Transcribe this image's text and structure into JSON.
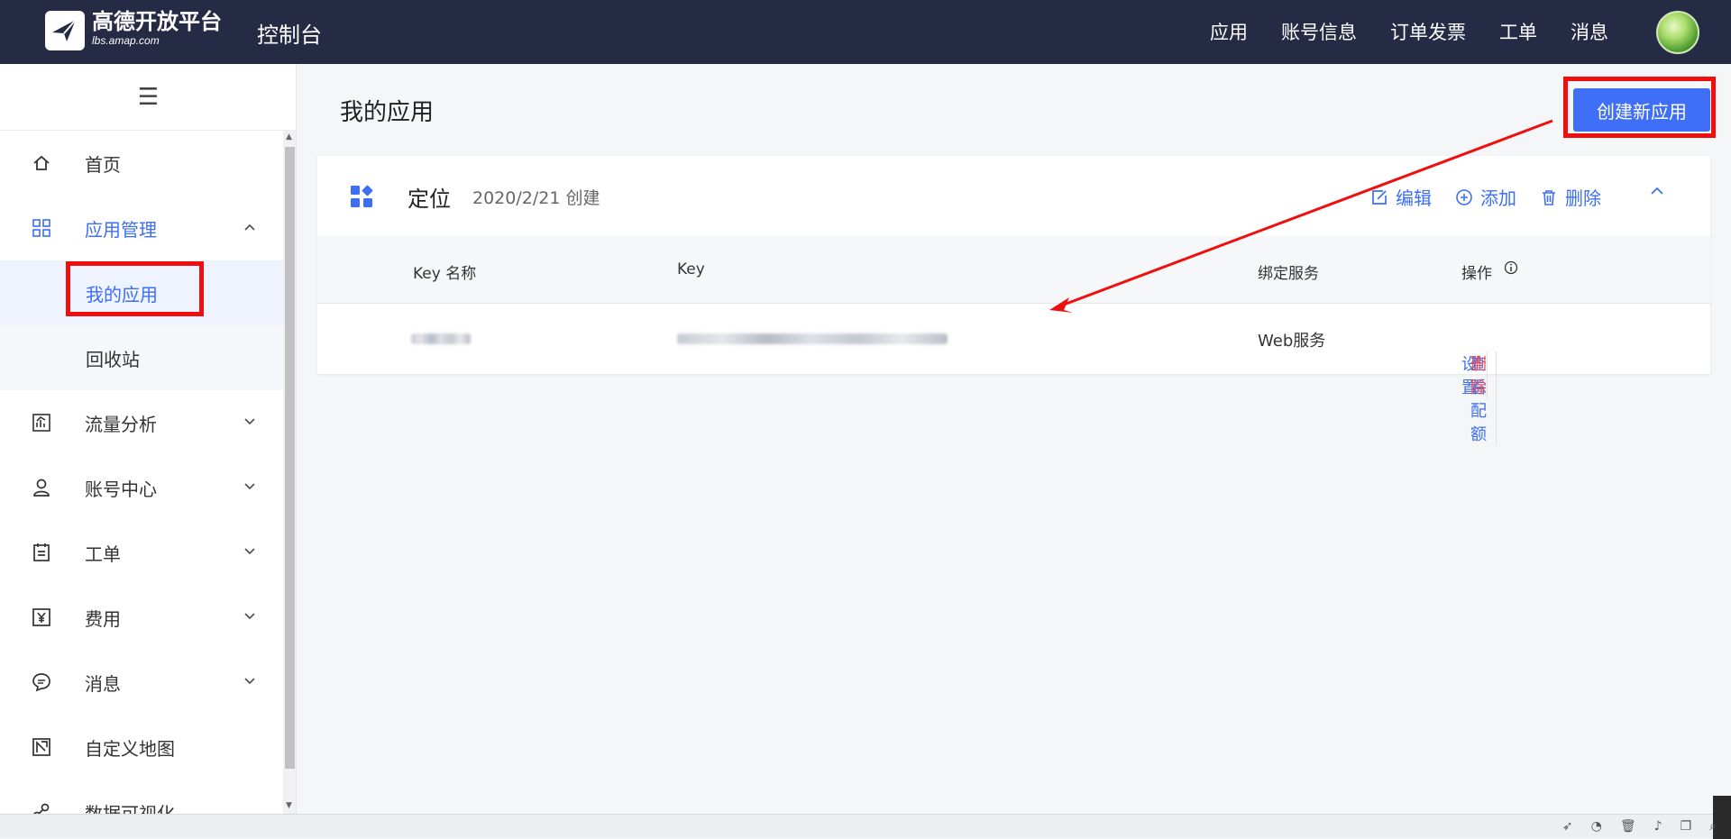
{
  "header": {
    "logo_name": "高德开放平台",
    "logo_url": "lbs.amap.com",
    "console": "控制台",
    "nav": [
      "应用",
      "账号信息",
      "订单发票",
      "工单",
      "消息"
    ]
  },
  "sidebar": {
    "items": [
      {
        "label": "首页",
        "icon": "home-icon"
      },
      {
        "label": "应用管理",
        "icon": "grid-icon"
      },
      {
        "label": "我的应用"
      },
      {
        "label": "回收站"
      },
      {
        "label": "流量分析",
        "icon": "chart-icon"
      },
      {
        "label": "账号中心",
        "icon": "user-icon"
      },
      {
        "label": "工单",
        "icon": "clipboard-icon"
      },
      {
        "label": "费用",
        "icon": "yen-icon"
      },
      {
        "label": "消息",
        "icon": "message-icon"
      },
      {
        "label": "自定义地图",
        "icon": "map-icon"
      },
      {
        "label": "数据可视化",
        "icon": "visual-icon"
      }
    ]
  },
  "main": {
    "title": "我的应用",
    "create_label": "创建新应用",
    "app": {
      "name": "定位",
      "created": "2020/2/21 创建",
      "actions": [
        "编辑",
        "添加",
        "删除"
      ]
    },
    "table": {
      "columns": [
        "Key 名称",
        "Key",
        "绑定服务",
        "操作"
      ],
      "rows": [
        {
          "service": "Web服务",
          "ops": [
            "设置",
            "查看配额",
            "删除"
          ]
        }
      ]
    }
  },
  "colors": {
    "accent": "#3f6ef7",
    "topbar": "#252a45",
    "highlight": "#f00f0f",
    "danger": "#f24b4b"
  }
}
